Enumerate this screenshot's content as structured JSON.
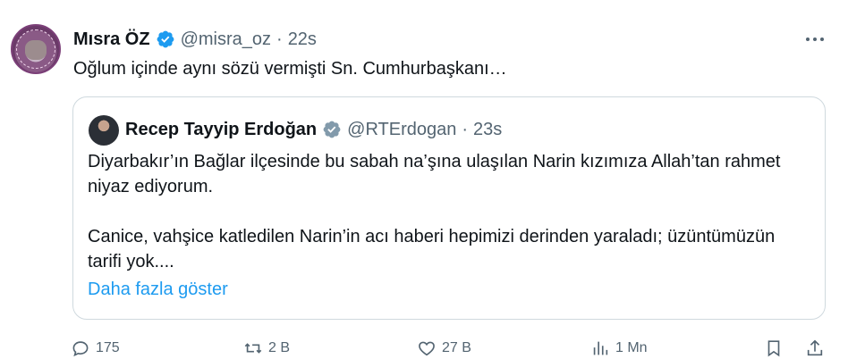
{
  "tweet": {
    "author_name": "Mısra ÖZ",
    "author_handle": "@misra_oz",
    "separator": "·",
    "time": "22s",
    "text": "Oğlum içinde aynı sözü vermişti Sn. Cumhurbaşkanı…"
  },
  "quoted": {
    "author_name": "Recep Tayyip Erdoğan",
    "author_handle": "@RTErdogan",
    "separator": "·",
    "time": "23s",
    "paragraph1": "Diyarbakır’ın Bağlar ilçesinde bu sabah na’şına ulaşılan Narin kızımıza Allah’tan rahmet niyaz ediyorum.",
    "paragraph2": "Canice, vahşice katledilen Narin’in acı haberi hepimizi derinden yaraladı; üzüntümüzün tarifi yok....",
    "show_more": "Daha fazla göster"
  },
  "actions": {
    "replies": "175",
    "retweets": "2 B",
    "likes": "27 B",
    "views": "1 Mn"
  },
  "icons": [
    "verified-badge-icon",
    "more-icon",
    "reply-icon",
    "retweet-icon",
    "like-icon",
    "views-icon",
    "bookmark-icon",
    "share-icon"
  ],
  "colors": {
    "verified_blue": "#1d9bf0",
    "verified_gray": "#829aab",
    "muted": "#536471",
    "link": "#1d9bf0"
  }
}
